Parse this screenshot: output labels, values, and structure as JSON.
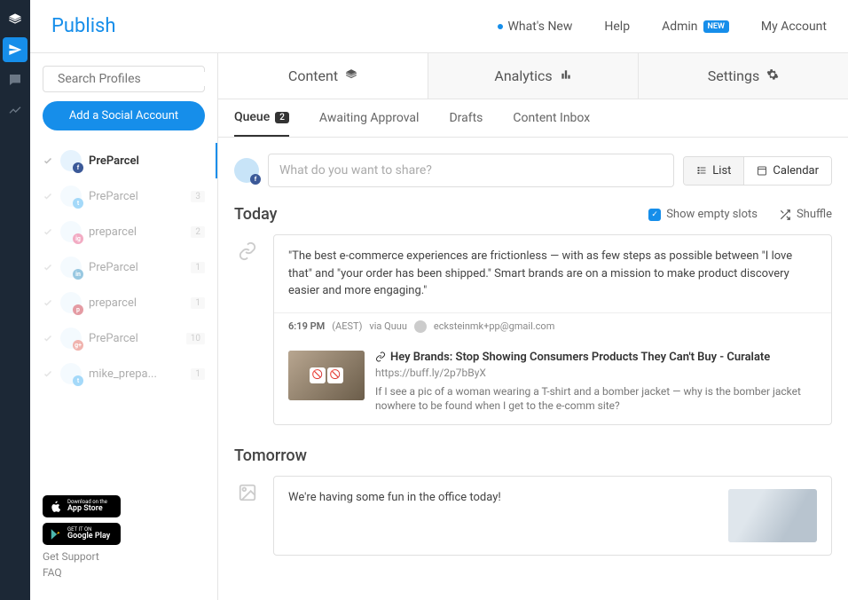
{
  "brand": "Publish",
  "topnav": {
    "whatsnew": "What's New",
    "help": "Help",
    "admin": "Admin",
    "admin_badge": "NEW",
    "account": "My Account"
  },
  "search_placeholder": "Search Profiles",
  "add_account": "Add a Social Account",
  "profiles": [
    {
      "name": "PreParcel",
      "net": "fb",
      "count": "",
      "selected": true
    },
    {
      "name": "PreParcel",
      "net": "tw",
      "count": "3"
    },
    {
      "name": "preparcel",
      "net": "ig",
      "count": "2"
    },
    {
      "name": "PreParcel",
      "net": "in",
      "count": "1"
    },
    {
      "name": "preparcel",
      "net": "pi",
      "count": "1"
    },
    {
      "name": "PreParcel",
      "net": "gp",
      "count": "10"
    },
    {
      "name": "mike_prepa...",
      "net": "tw",
      "count": "1"
    }
  ],
  "store": {
    "apple_small": "Download on the",
    "apple_big": "App Store",
    "google_small": "GET IT ON",
    "google_big": "Google Play"
  },
  "footer_links": {
    "support": "Get Support",
    "faq": "FAQ"
  },
  "tabs_top": {
    "content": "Content",
    "analytics": "Analytics",
    "settings": "Settings"
  },
  "subtabs": {
    "queue": "Queue",
    "queue_count": "2",
    "approval": "Awaiting Approval",
    "drafts": "Drafts",
    "inbox": "Content Inbox"
  },
  "composer_placeholder": "What do you want to share?",
  "view": {
    "list": "List",
    "calendar": "Calendar"
  },
  "sections": {
    "today": "Today",
    "tomorrow": "Tomorrow",
    "show_empty": "Show empty slots",
    "shuffle": "Shuffle"
  },
  "post1": {
    "text": "\"The best e-commerce experiences are frictionless — with as few steps as possible between \"I love that\" and \"your order has been shipped.\" Smart brands are on a mission to make product discovery easier and more engaging.\"",
    "time": "6:19 PM",
    "tz": "(AEST)",
    "via": "via Quuu",
    "author": "ecksteinmk+pp@gmail.com",
    "link_title": "Hey Brands: Stop Showing Consumers Products They Can't Buy - Curalate",
    "link_url": "https://buff.ly/2p7bByX",
    "link_desc": "If I see a pic of a woman wearing a T-shirt and a bomber jacket — why is the bomber jacket nowhere to be found when I get to the e-comm site?"
  },
  "post2": {
    "text": "We're having some fun in the office today!"
  }
}
